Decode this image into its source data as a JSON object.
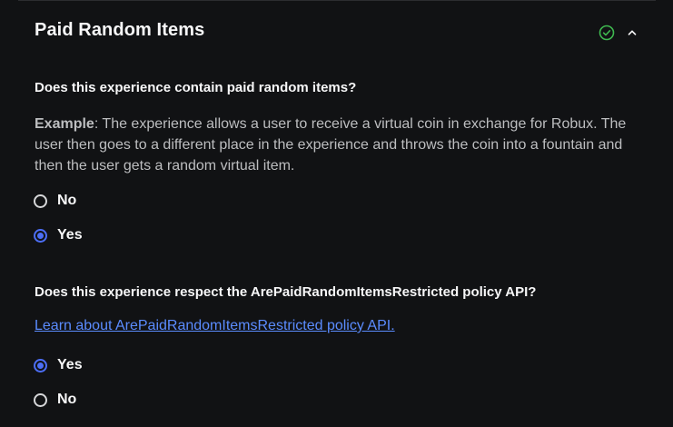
{
  "section": {
    "title": "Paid Random Items",
    "status_icon": "check-circle-icon",
    "collapse_icon": "chevron-up-icon",
    "colors": {
      "accent": "#4c6ef5",
      "success": "#3fb950",
      "link": "#5b8cff",
      "background": "#111214"
    }
  },
  "question1": {
    "text": "Does this experience contain paid random items?",
    "example_label": "Example",
    "example_text": ": The experience allows a user to receive a virtual coin in exchange for Robux. The user then goes to a different place in the experience and throws the coin into a fountain and then the user gets a random virtual item.",
    "options": [
      {
        "label": "No",
        "selected": false
      },
      {
        "label": "Yes",
        "selected": true
      }
    ]
  },
  "question2": {
    "text": "Does this experience respect the ArePaidRandomItemsRestricted policy API?",
    "link_text": "Learn about ArePaidRandomItemsRestricted policy API.",
    "options": [
      {
        "label": "Yes",
        "selected": true
      },
      {
        "label": "No",
        "selected": false
      }
    ]
  }
}
